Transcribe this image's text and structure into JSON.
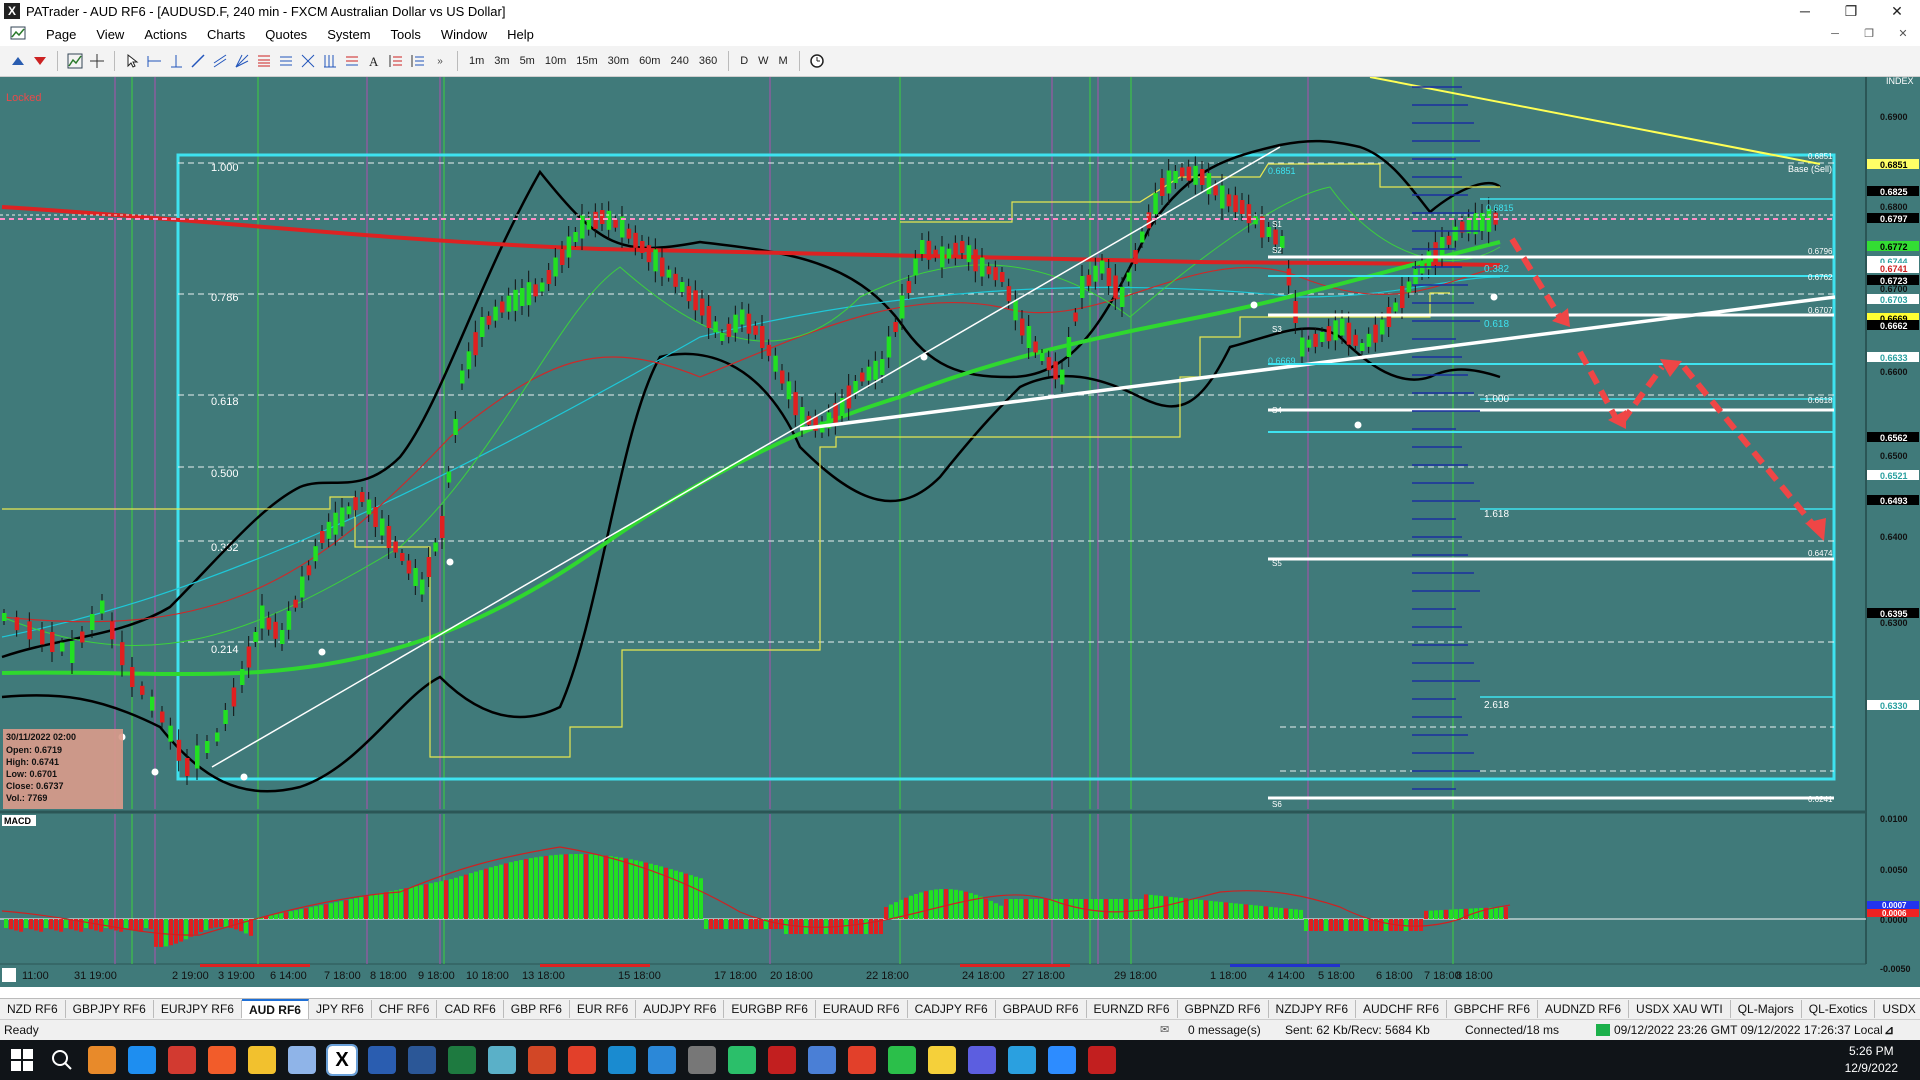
{
  "window": {
    "title": "PATrader - AUD RF6 - [AUDUSD.F, 240 min - FXCM Australian Dollar vs US Dollar]",
    "app_icon_text": "X",
    "minimize": "─",
    "restore": "❐",
    "close": "✕"
  },
  "menu": [
    "Page",
    "View",
    "Actions",
    "Charts",
    "Quotes",
    "System",
    "Tools",
    "Window",
    "Help"
  ],
  "mdi_buttons": [
    "─",
    "❐",
    "✕"
  ],
  "timeframes": [
    "1m",
    "3m",
    "5m",
    "10m",
    "15m",
    "30m",
    "60m",
    "240",
    "360",
    "D",
    "W",
    "M"
  ],
  "chart": {
    "locked_label": "Locked",
    "index_label": "INDEX",
    "base_sell_label": "Base (Sell)",
    "macd_label": "MACD",
    "price_axis": [
      "0.6900",
      "0.6800",
      "0.6700",
      "0.6600",
      "0.6500",
      "0.6400",
      "0.6300"
    ],
    "price_tags": [
      {
        "text": "0.6851",
        "bg": "#ffff66",
        "fg": "#000000"
      },
      {
        "text": "0.6825",
        "bg": "#000000",
        "fg": "#ffffff"
      },
      {
        "text": "0.6797",
        "bg": "#000000",
        "fg": "#ffffff"
      },
      {
        "text": "0.6772",
        "bg": "#33dd33",
        "fg": "#000000"
      },
      {
        "text": "0.6744",
        "bg": "#ffffff",
        "fg": "#2aa0a0"
      },
      {
        "text": "0.6741",
        "bg": "#ffffff",
        "fg": "#cc2222"
      },
      {
        "text": "0.6723",
        "bg": "#000000",
        "fg": "#ffffff"
      },
      {
        "text": "0.6703",
        "bg": "#ffffff",
        "fg": "#2aa0a0"
      },
      {
        "text": "0.6669",
        "bg": "#ffff33",
        "fg": "#000000"
      },
      {
        "text": "0.6662",
        "bg": "#000000",
        "fg": "#ffffff"
      },
      {
        "text": "0.6633",
        "bg": "#ffffff",
        "fg": "#2aa0a0"
      },
      {
        "text": "0.6562",
        "bg": "#000000",
        "fg": "#ffffff"
      },
      {
        "text": "0.6521",
        "bg": "#ffffff",
        "fg": "#2aa0a0"
      },
      {
        "text": "0.6493",
        "bg": "#000000",
        "fg": "#ffffff"
      },
      {
        "text": "0.6395",
        "bg": "#000000",
        "fg": "#ffffff"
      },
      {
        "text": "0.6330",
        "bg": "#ffffff",
        "fg": "#2aa0a0"
      }
    ],
    "fib_levels": [
      "1.000",
      "0.786",
      "0.618",
      "0.500",
      "0.382",
      "0.214"
    ],
    "fib_ext_labels": [
      "0.618",
      "1.000",
      "1.618",
      "2.618",
      "0.382"
    ],
    "pivot_labels": [
      "S1",
      "S2",
      "S3",
      "S4",
      "S5",
      "S6"
    ],
    "pivot_values": [
      "0.6851",
      "0.6796",
      "0.6762",
      "0.6707",
      "0.6618",
      "0.6474",
      "0.6241",
      "0.6815",
      "0.6669"
    ],
    "ohlc_box": {
      "date": "30/11/2022 02:00",
      "open": "Open: 0.6719",
      "high": "High: 0.6741",
      "low": "Low: 0.6701",
      "close": "Close: 0.6737",
      "vol": "Vol.: 7769"
    },
    "macd_axis": [
      "0.0100",
      "0.0050",
      "0.0000",
      "-0.0050"
    ],
    "macd_tags": [
      {
        "text": "0.0007",
        "bg": "#2233ee",
        "fg": "#ffffff"
      },
      {
        "text": "0.0006",
        "bg": "#ee2222",
        "fg": "#ffffff"
      }
    ],
    "time_axis": [
      "11:00",
      "31 19:00",
      "2 19:00",
      "3 19:00",
      "6 14:00",
      "7 18:00",
      "8 18:00",
      "9 18:00",
      "10 18:00",
      "13 18:00",
      "15 18:00",
      "17 18:00",
      "20 18:00",
      "22 18:00",
      "24 18:00",
      "27 18:00",
      "29 18:00",
      "1 18:00",
      "4 14:00",
      "5 18:00",
      "6 18:00",
      "7 18:00",
      "8 18:00"
    ]
  },
  "tabs": [
    "NZD RF6",
    "GBPJPY RF6",
    "EURJPY RF6",
    "AUD RF6",
    "JPY RF6",
    "CHF RF6",
    "CAD RF6",
    "GBP RF6",
    "EUR RF6",
    "AUDJPY RF6",
    "EURGBP RF6",
    "EURAUD RF6",
    "CADJPY RF6",
    "GBPAUD RF6",
    "EURNZD RF6",
    "GBPNZD RF6",
    "NZDJPY RF6",
    "AUDCHF RF6",
    "GBPCHF RF6",
    "AUDNZD RF6",
    "USDX XAU WTI",
    "QL-Majors",
    "QL-Exotics",
    "USDX RF6",
    "Bitcoin",
    "SP500"
  ],
  "active_tab": "AUD RF6",
  "status": {
    "ready": "Ready",
    "messages": "0 message(s)",
    "traffic": "Sent: 62 Kb/Recv: 5684 Kb",
    "connection": "Connected/18 ms",
    "times": "09/12/2022 23:26 GMT  09/12/2022 17:26:37 Local"
  },
  "taskbar": {
    "time": "5:26 PM",
    "date": "12/9/2022",
    "icons": [
      "start-icon",
      "search-icon",
      "firefox-icon",
      "edge-icon",
      "chrome-icon",
      "brave-icon",
      "file-explorer-icon",
      "notepad-icon",
      "patrader-icon",
      "calculator-icon",
      "word-icon",
      "excel-icon",
      "image-viewer-icon",
      "powerpoint-icon",
      "app-s-icon",
      "skype-icon",
      "remote-icon",
      "app-gray-icon",
      "tradingview-icon",
      "app-red-icon",
      "app-blue-icon",
      "app-red2-icon",
      "app-green-icon",
      "sticky-notes-icon",
      "teams-icon",
      "telegram-icon",
      "zoom-icon",
      "app-red3-icon"
    ]
  }
}
